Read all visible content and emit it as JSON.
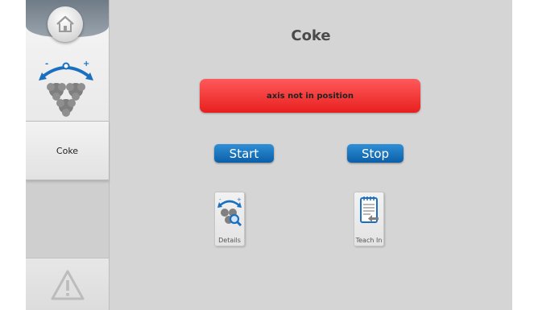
{
  "screen": {
    "title": "Coke"
  },
  "sidebar": {
    "home_icon": "home-icon",
    "axis_icon": "axis-adjust-icon",
    "items": [
      {
        "label": "Coke"
      }
    ],
    "warning_icon": "warning-triangle-icon"
  },
  "alarm": {
    "message": "axis not in position",
    "color": "#e83030"
  },
  "controls": {
    "start_label": "Start",
    "stop_label": "Stop",
    "button_color": "#1577c2"
  },
  "tiles": [
    {
      "label": "Details",
      "icon": "details-magnifier-icon"
    },
    {
      "label": "Teach In",
      "icon": "teach-in-notepad-icon"
    }
  ]
}
